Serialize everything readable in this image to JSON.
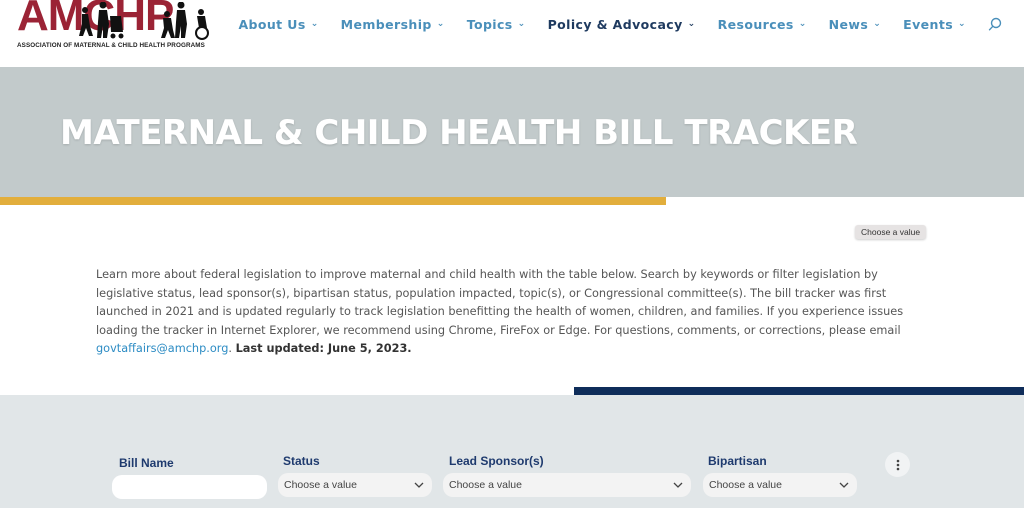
{
  "header": {
    "logo_text": "AMCHP",
    "logo_subtitle": "ASSOCIATION OF MATERNAL & CHILD HEALTH PROGRAMS",
    "nav": [
      {
        "label": "About Us",
        "active": false
      },
      {
        "label": "Membership",
        "active": false
      },
      {
        "label": "Topics",
        "active": false
      },
      {
        "label": "Policy & Advocacy",
        "active": true
      },
      {
        "label": "Resources",
        "active": false
      },
      {
        "label": "News",
        "active": false
      },
      {
        "label": "Events",
        "active": false
      }
    ],
    "search_icon": "search-icon"
  },
  "hero": {
    "title": "MATERNAL & CHILD HEALTH BILL TRACKER"
  },
  "tooltip": {
    "text": "Choose a value"
  },
  "intro": {
    "text": "Learn more about federal legislation to improve maternal and child health with the table below. Search by keywords or filter legislation by legislative status, lead sponsor(s), bipartisan status, population impacted, topic(s), or Congressional committee(s). The bill tracker was first launched in 2021 and is updated regularly to track legislation benefitting the health of women, children, and families. If you experience issues loading the tracker in Internet Explorer, we recommend using Chrome, FireFox or Edge. For questions, comments, or corrections, please email ",
    "email": "govtaffairs@amchp.org",
    "after_email": ". ",
    "last_updated": "Last updated: June 5, 2023."
  },
  "filters": {
    "bill_name": {
      "label": "Bill Name",
      "value": "",
      "placeholder": ""
    },
    "status": {
      "label": "Status",
      "value": "Choose a value"
    },
    "lead_sponsor": {
      "label": "Lead Sponsor(s)",
      "value": "Choose a value"
    },
    "bipartisan": {
      "label": "Bipartisan",
      "value": "Choose a value"
    },
    "more_icon": "more-vertical-icon"
  },
  "colors": {
    "brand_red": "#9b2335",
    "nav_blue": "#4a8fba",
    "nav_active": "#1e3a5f",
    "hero_bg": "#c2cacb",
    "gold_accent": "#e2ae3c",
    "navy_accent": "#0f2d5a",
    "filter_bg": "#e1e6e8",
    "link": "#2d8cc4"
  }
}
